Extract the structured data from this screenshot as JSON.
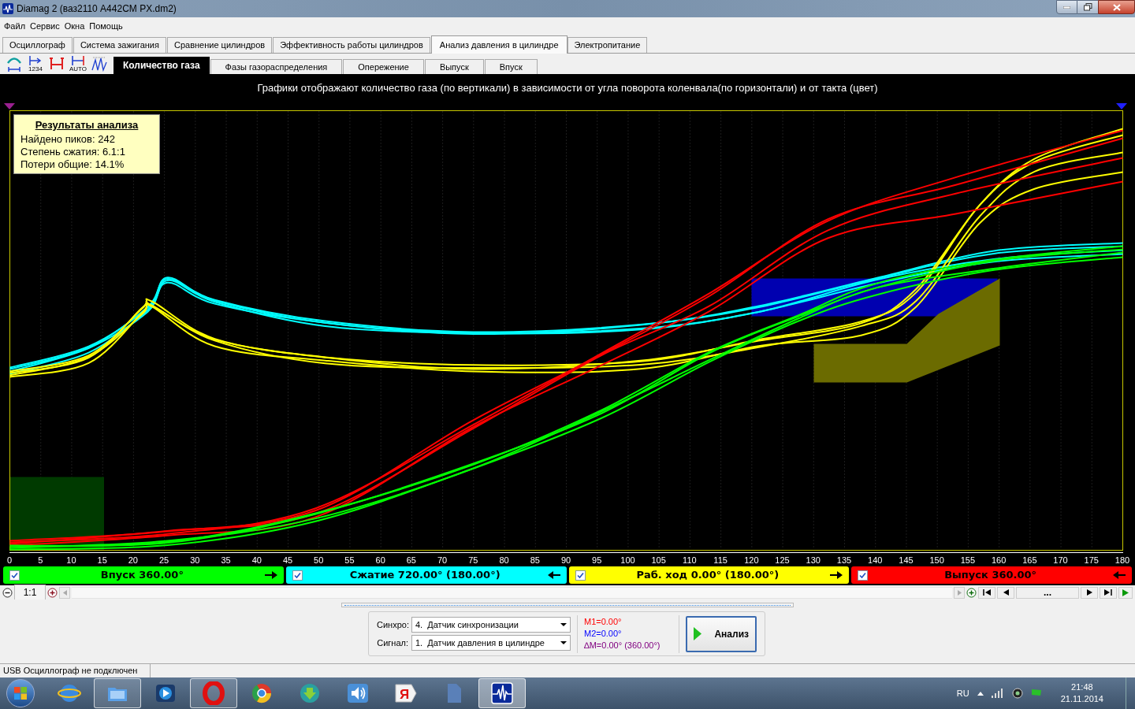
{
  "window": {
    "title": "Diamag 2 (ваз2110  A442CM PX.dm2)"
  },
  "menu": [
    "Файл",
    "Сервис",
    "Окна",
    "Помощь"
  ],
  "tabs": [
    {
      "label": "Осциллограф",
      "selected": false
    },
    {
      "label": "Система зажигания",
      "selected": false
    },
    {
      "label": "Сравнение цилиндров",
      "selected": false
    },
    {
      "label": "Эффективность работы цилиндров",
      "selected": false
    },
    {
      "label": "Анализ давления в цилиндре",
      "selected": true
    },
    {
      "label": "Электропитание",
      "selected": false
    }
  ],
  "toolbar": [
    {
      "kind": "wave"
    },
    {
      "kind": "numbered",
      "caption": "1234"
    },
    {
      "kind": "span"
    },
    {
      "kind": "auto",
      "caption": "AUTO"
    },
    {
      "kind": "peaks"
    }
  ],
  "subtabs": [
    {
      "label": "Количество газа",
      "selected": true
    },
    {
      "label": "Фазы газораспределения",
      "selected": false
    },
    {
      "label": "Опережение",
      "selected": false
    },
    {
      "label": "Выпуск",
      "selected": false
    },
    {
      "label": "Впуск",
      "selected": false
    }
  ],
  "chart": {
    "caption": "Графики отображают количество газа (по вертикали) в зависимости от угла поворота коленвала(по горизонтали) и от такта (цвет)",
    "x_labels": [
      "0",
      "5",
      "10",
      "15",
      "20",
      "25",
      "30",
      "35",
      "40",
      "45",
      "50",
      "55",
      "60",
      "65",
      "70",
      "75",
      "80",
      "85",
      "90",
      "95",
      "100",
      "105",
      "110",
      "115",
      "120",
      "125",
      "130",
      "135",
      "140",
      "145",
      "150",
      "155",
      "160",
      "165",
      "170",
      "175",
      "180"
    ],
    "results": {
      "title": "Результаты анализа",
      "lines": [
        "Найдено пиков: 242",
        "Степень сжатия: 6.1:1",
        "Потери общие: 14.1%"
      ]
    }
  },
  "strokes": [
    {
      "label": "Впуск 360.00°",
      "color": "#00ff00",
      "checked": true,
      "kind": "forward"
    },
    {
      "label": "Сжатие 720.00° (180.00°)",
      "color": "#00ffff",
      "checked": true,
      "kind": "backward"
    },
    {
      "label": "Раб. ход 0.00° (180.00°)",
      "color": "#ffff00",
      "checked": true,
      "kind": "forward"
    },
    {
      "label": "Выпуск 360.00°",
      "color": "#ff0000",
      "checked": true,
      "kind": "backward"
    }
  ],
  "zoom": {
    "ratio": "1:1"
  },
  "navigator": {
    "position": "..."
  },
  "controls": {
    "sync": {
      "label": "Синхро:",
      "value": "4.  Датчик синхронизации"
    },
    "signal": {
      "label": "Сигнал:",
      "value": "1.  Датчик давления в цилиндре"
    },
    "markers": [
      {
        "text": "M1=0.00°",
        "color": "#ff0000"
      },
      {
        "text": "M2=0.00°",
        "color": "#0000ff"
      },
      {
        "text": "∆M=0.00° (360.00°)",
        "color": "#800080"
      }
    ],
    "analyze_button": "Анализ"
  },
  "status_bar": "USB Осциллограф не подключен",
  "taskbar": {
    "apps": [
      {
        "kind": "globe",
        "running": false,
        "selected": false
      },
      {
        "kind": "folder",
        "running": true,
        "selected": false
      },
      {
        "kind": "media",
        "running": false,
        "selected": false
      },
      {
        "kind": "ring",
        "running": true,
        "selected": false
      },
      {
        "kind": "wheel",
        "running": false,
        "selected": false
      },
      {
        "kind": "download",
        "running": false,
        "selected": false
      },
      {
        "kind": "speaker",
        "running": false,
        "selected": false
      },
      {
        "kind": "letter",
        "glyph": "Я",
        "running": false,
        "selected": false
      },
      {
        "kind": "file",
        "running": false,
        "selected": false
      },
      {
        "kind": "wave",
        "running": true,
        "selected": true
      }
    ],
    "language": "RU",
    "time": "21:48",
    "date": "21.11.2014"
  }
}
